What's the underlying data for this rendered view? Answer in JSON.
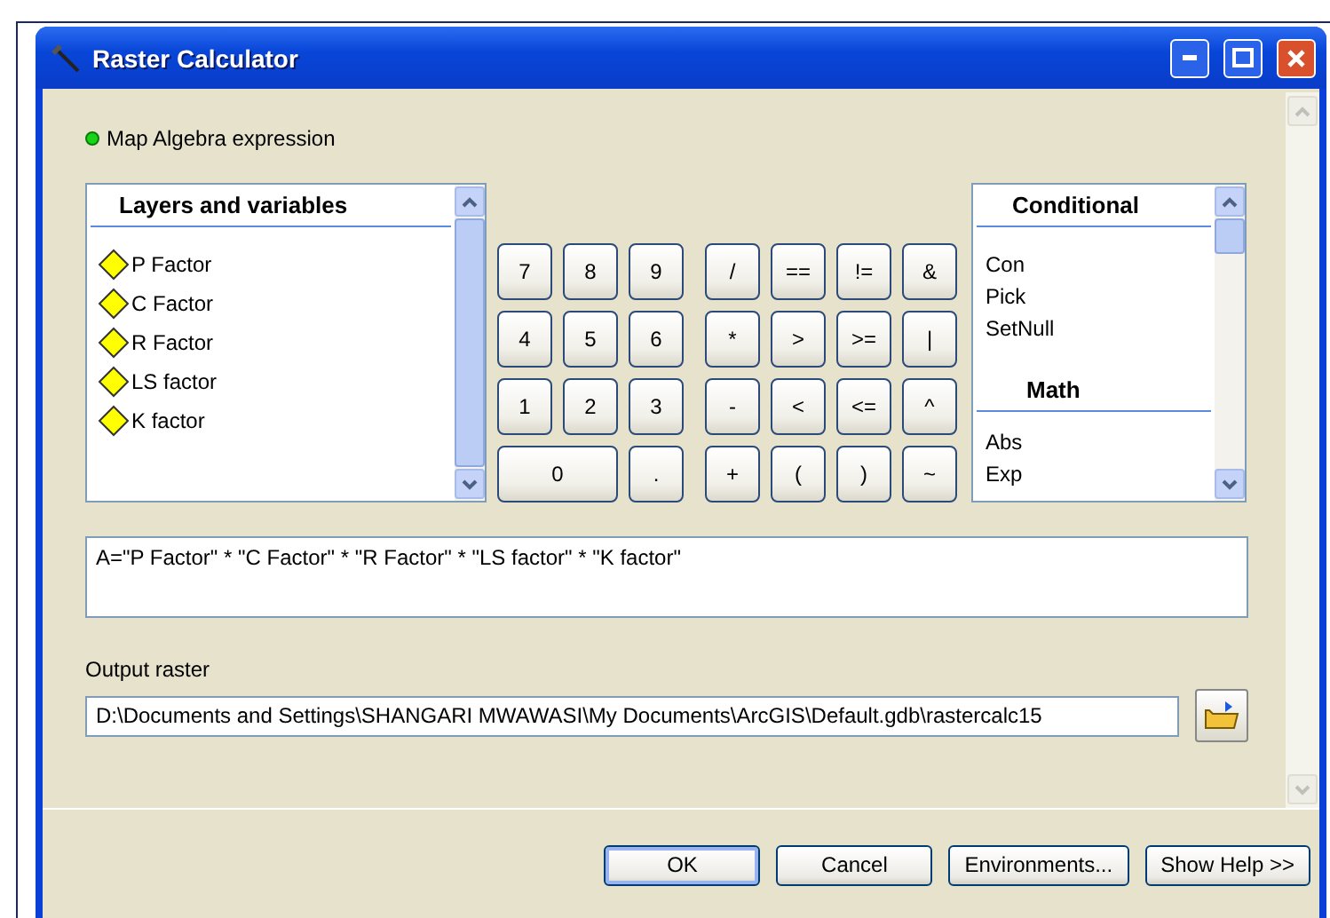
{
  "window": {
    "title": "Raster Calculator"
  },
  "expression_label": "Map Algebra expression",
  "layers_panel": {
    "title": "Layers and variables",
    "items": [
      "P Factor",
      "C Factor",
      "R Factor",
      "LS factor",
      "K factor"
    ]
  },
  "keypad": {
    "digits": [
      [
        {
          "label": "7",
          "kind": "key"
        },
        {
          "label": "8",
          "kind": "key"
        },
        {
          "label": "9",
          "kind": "key"
        }
      ],
      [
        {
          "label": "4",
          "kind": "key"
        },
        {
          "label": "5",
          "kind": "key"
        },
        {
          "label": "6",
          "kind": "key"
        }
      ],
      [
        {
          "label": "1",
          "kind": "key"
        },
        {
          "label": "2",
          "kind": "key"
        },
        {
          "label": "3",
          "kind": "key"
        }
      ],
      [
        {
          "label": "0",
          "kind": "wide"
        },
        {
          "label": ".",
          "kind": "key"
        }
      ]
    ],
    "operators": [
      [
        "/",
        "==",
        "!=",
        "&"
      ],
      [
        "*",
        ">",
        ">=",
        "|"
      ],
      [
        "-",
        "<",
        "<=",
        "^"
      ],
      [
        "+",
        "(",
        ")",
        "~"
      ]
    ]
  },
  "functions_panel": {
    "sections": [
      {
        "title": "Conditional",
        "items": [
          "Con",
          "Pick",
          "SetNull"
        ]
      },
      {
        "title": "Math",
        "items": [
          "Abs",
          "Exp"
        ]
      }
    ]
  },
  "expression": "A=\"P Factor\" * \"C Factor\" * \"R Factor\" * \"LS factor\" * \"K factor\"",
  "output_raster": {
    "label": "Output raster",
    "value": "D:\\Documents and Settings\\SHANGARI MWAWASI\\My Documents\\ArcGIS\\Default.gdb\\rastercalc15"
  },
  "buttons": [
    {
      "label": "OK",
      "default": true
    },
    {
      "label": "Cancel",
      "default": false
    },
    {
      "label": "Environments...",
      "default": false
    },
    {
      "label": "Show Help >>",
      "default": false
    }
  ]
}
